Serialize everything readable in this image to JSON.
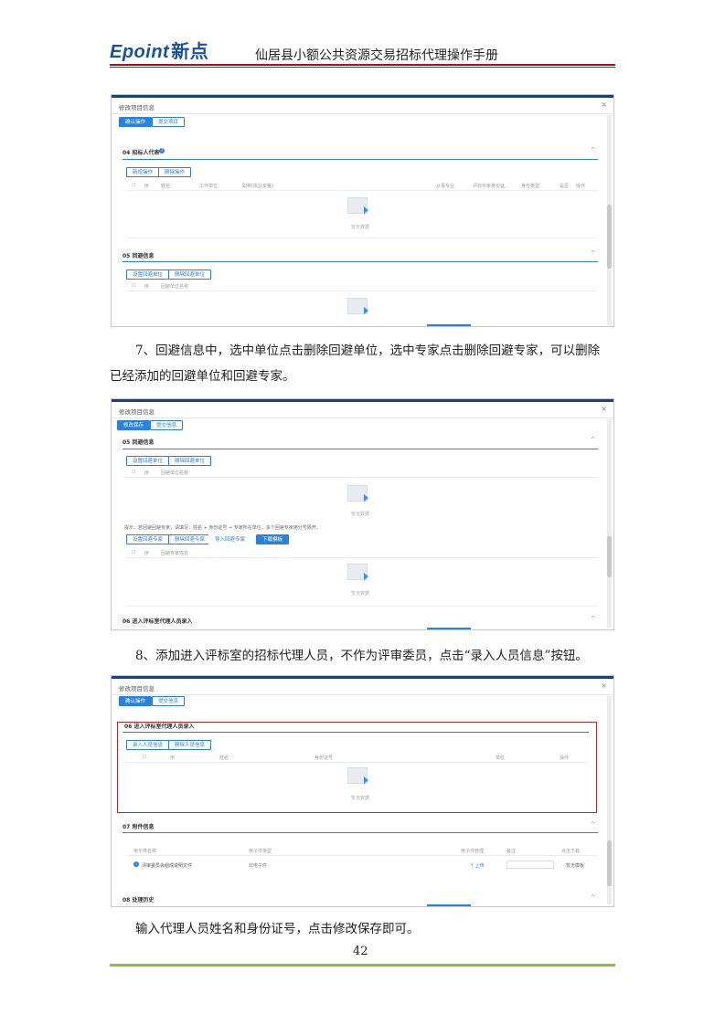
{
  "header": {
    "logo_en": "Epoint",
    "logo_cn": "新点",
    "title": "仙居县小额公共资源交易招标代理操作手册"
  },
  "shot1": {
    "title": "修改项目信息",
    "tab_active": "确认操作",
    "tab2": "提交项目",
    "sec04": {
      "label": "04 招标人代表",
      "btn1": "新增操作",
      "btn2": "删除操作",
      "cols": [
        "序",
        "姓名",
        "工作单位",
        "职称(执业资格)",
        "从事专业",
        "评标专家身份证...",
        "身份类型",
        "是否",
        "操作"
      ],
      "nodata": "暂无数据"
    },
    "sec05": {
      "label": "05 回避信息",
      "btn1": "设置回避单位",
      "btn2": "删除回避单位",
      "cols": [
        "序",
        "回避单位名称"
      ]
    }
  },
  "para1_line1": "7、回避信息中，选中单位点击删除回避单位，选中专家点击删除回避专家，可以删除",
  "para1_line2": "已经添加的回避单位和回避专家。",
  "shot2": {
    "title": "修改项目信息",
    "tab_active": "修改保存",
    "tab2": "提交信息",
    "sec05": {
      "label": "05 回避信息",
      "btn1": "设置回避单位",
      "btn2": "删除回避单位",
      "cols": [
        "序",
        "回避单位名称"
      ],
      "nodata": "暂无数据"
    },
    "hint": "提示：若回避回避专家，请填写：姓名 + 身份证号 + 专家所在单位，多个回避专家用分号隔开。",
    "btn3": "设置回避专家",
    "btn4": "删除回避专家",
    "btn5": "导入回避专家",
    "btn6": "下载模板",
    "cols2": [
      "序",
      "回避专家姓名"
    ],
    "nodata2": "暂无数据",
    "sec06": "06 进入评标室代理人员录入"
  },
  "para2": "8、添加进入评标室的招标代理人员，不作为评审委员，点击“录入人员信息”按钮。",
  "shot3": {
    "title": "修改项目信息",
    "tab_active": "确认操作",
    "tab2": "提交信息",
    "sec06": {
      "label": "06 进入评标室代理人员录入",
      "btn1": "录入人员信息",
      "btn2": "删除人员信息",
      "cols": [
        "序",
        "姓名",
        "身份证号",
        "单位",
        "操作"
      ],
      "nodata": "暂无数据"
    },
    "sec07": {
      "label": "07 附件信息",
      "cols": [
        "电子件名称",
        "电子件类型",
        "电子件管理",
        "备注",
        "点击下载"
      ],
      "row": {
        "name": "评审委员会组成说明文件",
        "type": "非电子件",
        "upload": "上传",
        "status": "暂无模板"
      }
    },
    "sec08": "08 处理历史"
  },
  "para3": "输入代理人员姓名和身份证号，点击修改保存即可。",
  "page_number": "42"
}
